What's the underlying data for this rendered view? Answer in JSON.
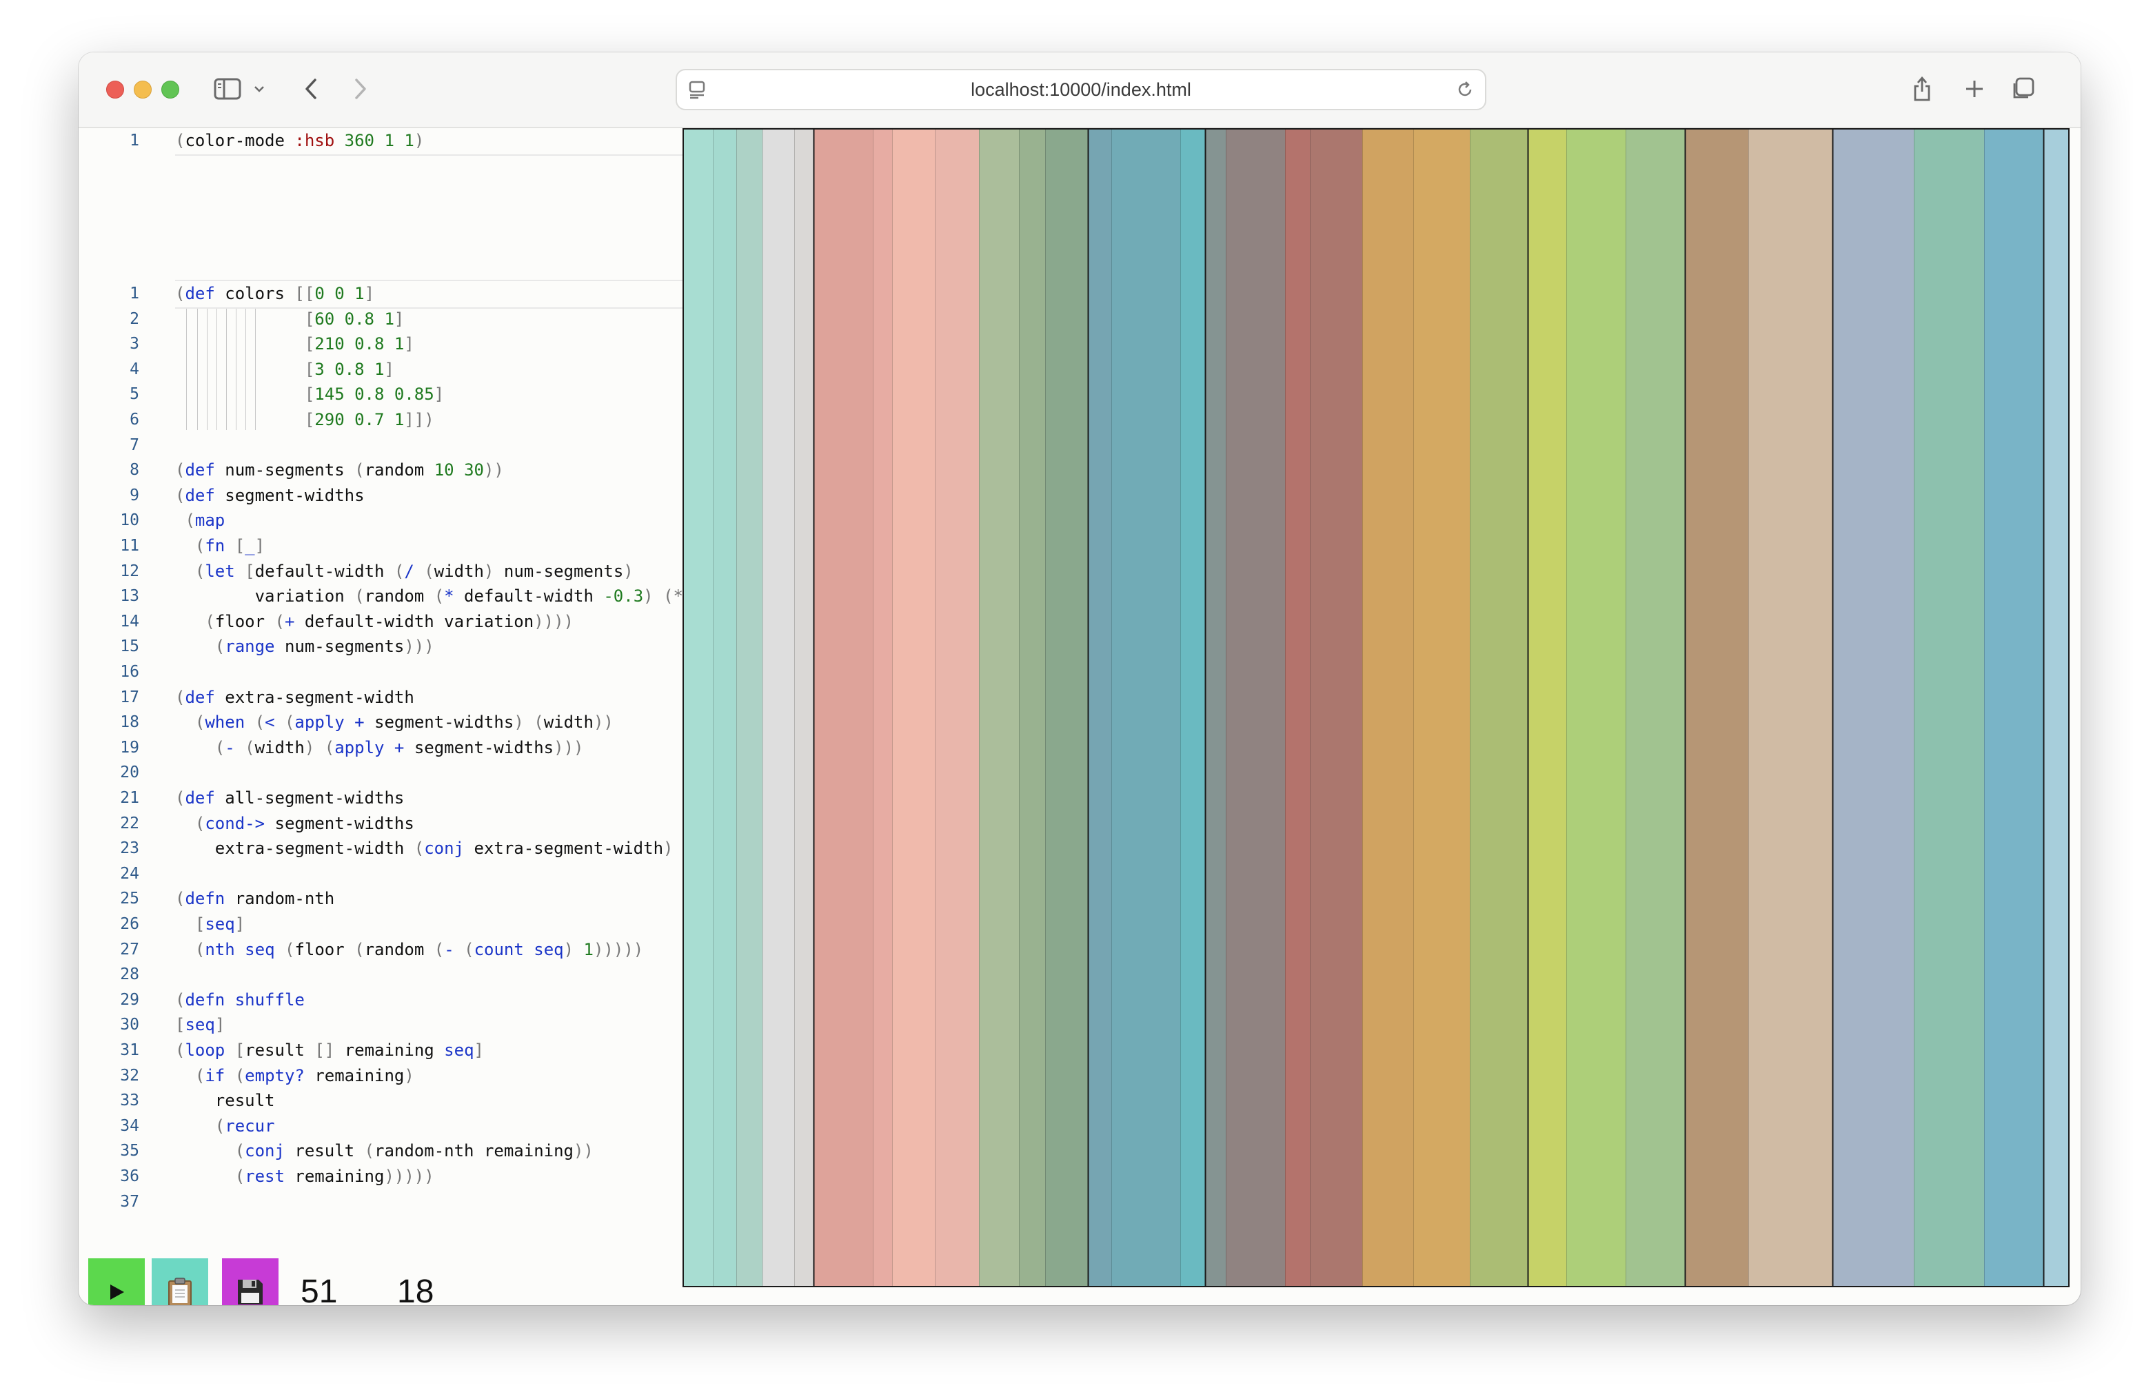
{
  "browser": {
    "url": "localhost:10000/index.html"
  },
  "editor_setup": {
    "lines": [
      {
        "n": "1",
        "tokens": [
          [
            "br",
            "("
          ],
          [
            "t",
            "color-mode "
          ],
          [
            "kwd",
            ":hsb"
          ],
          [
            "t",
            " "
          ],
          [
            "num",
            "360 1 1"
          ],
          [
            "br",
            ")"
          ]
        ]
      }
    ]
  },
  "editor_main": {
    "lines": [
      {
        "n": "1",
        "tokens": [
          [
            "br",
            "("
          ],
          [
            "kw",
            "def"
          ],
          [
            "t",
            " colors "
          ],
          [
            "br",
            "[["
          ],
          [
            "num",
            "0 0 1"
          ],
          [
            "br",
            "]"
          ]
        ]
      },
      {
        "n": "2",
        "tokens": [
          [
            "t",
            "             "
          ],
          [
            "br",
            "["
          ],
          [
            "num",
            "60 0.8 1"
          ],
          [
            "br",
            "]"
          ]
        ]
      },
      {
        "n": "3",
        "tokens": [
          [
            "t",
            "             "
          ],
          [
            "br",
            "["
          ],
          [
            "num",
            "210 0.8 1"
          ],
          [
            "br",
            "]"
          ]
        ]
      },
      {
        "n": "4",
        "tokens": [
          [
            "t",
            "             "
          ],
          [
            "br",
            "["
          ],
          [
            "num",
            "3 0.8 1"
          ],
          [
            "br",
            "]"
          ]
        ]
      },
      {
        "n": "5",
        "tokens": [
          [
            "t",
            "             "
          ],
          [
            "br",
            "["
          ],
          [
            "num",
            "145 0.8 0.85"
          ],
          [
            "br",
            "]"
          ]
        ]
      },
      {
        "n": "6",
        "tokens": [
          [
            "t",
            "             "
          ],
          [
            "br",
            "["
          ],
          [
            "num",
            "290 0.7 1"
          ],
          [
            "br",
            "]])"
          ]
        ]
      },
      {
        "n": "7",
        "tokens": []
      },
      {
        "n": "8",
        "tokens": [
          [
            "br",
            "("
          ],
          [
            "kw",
            "def"
          ],
          [
            "t",
            " num-segments "
          ],
          [
            "br",
            "("
          ],
          [
            "t",
            "random "
          ],
          [
            "num",
            "10 30"
          ],
          [
            "br",
            "))"
          ]
        ]
      },
      {
        "n": "9",
        "tokens": [
          [
            "br",
            "("
          ],
          [
            "kw",
            "def"
          ],
          [
            "t",
            " segment-widths"
          ]
        ]
      },
      {
        "n": "10",
        "tokens": [
          [
            "t",
            " "
          ],
          [
            "br",
            "("
          ],
          [
            "kw",
            "map"
          ]
        ]
      },
      {
        "n": "11",
        "tokens": [
          [
            "t",
            "  "
          ],
          [
            "br",
            "("
          ],
          [
            "kw",
            "fn"
          ],
          [
            "t",
            " "
          ],
          [
            "br",
            "["
          ],
          [
            "kw",
            "_"
          ],
          [
            "br",
            "]"
          ]
        ]
      },
      {
        "n": "12",
        "tokens": [
          [
            "t",
            "  "
          ],
          [
            "br",
            "("
          ],
          [
            "kw",
            "let"
          ],
          [
            "t",
            " "
          ],
          [
            "br",
            "["
          ],
          [
            "t",
            "default-width "
          ],
          [
            "br",
            "("
          ],
          [
            "kw",
            "/"
          ],
          [
            "t",
            " "
          ],
          [
            "br",
            "("
          ],
          [
            "t",
            "width"
          ],
          [
            "br",
            ")"
          ],
          [
            "t",
            " num-segments"
          ],
          [
            "br",
            ")"
          ]
        ]
      },
      {
        "n": "13",
        "tokens": [
          [
            "t",
            "        variation "
          ],
          [
            "br",
            "("
          ],
          [
            "t",
            "random "
          ],
          [
            "br",
            "("
          ],
          [
            "kw",
            "*"
          ],
          [
            "t",
            " default-width "
          ],
          [
            "num",
            "-0.3"
          ],
          [
            "br",
            ")"
          ],
          [
            "t",
            " "
          ],
          [
            "br",
            "(*"
          ]
        ]
      },
      {
        "n": "14",
        "tokens": [
          [
            "t",
            "   "
          ],
          [
            "br",
            "("
          ],
          [
            "t",
            "floor "
          ],
          [
            "br",
            "("
          ],
          [
            "kw",
            "+"
          ],
          [
            "t",
            " default-width variation"
          ],
          [
            "br",
            "))))"
          ]
        ]
      },
      {
        "n": "15",
        "tokens": [
          [
            "t",
            "    "
          ],
          [
            "br",
            "("
          ],
          [
            "kw",
            "range"
          ],
          [
            "t",
            " num-segments"
          ],
          [
            "br",
            ")))"
          ]
        ]
      },
      {
        "n": "16",
        "tokens": []
      },
      {
        "n": "17",
        "tokens": [
          [
            "br",
            "("
          ],
          [
            "kw",
            "def"
          ],
          [
            "t",
            " extra-segment-width"
          ]
        ]
      },
      {
        "n": "18",
        "tokens": [
          [
            "t",
            "  "
          ],
          [
            "br",
            "("
          ],
          [
            "kw",
            "when"
          ],
          [
            "t",
            " "
          ],
          [
            "br",
            "("
          ],
          [
            "kw",
            "<"
          ],
          [
            "t",
            " "
          ],
          [
            "br",
            "("
          ],
          [
            "kw",
            "apply"
          ],
          [
            "t",
            " "
          ],
          [
            "kw",
            "+"
          ],
          [
            "t",
            " segment-widths"
          ],
          [
            "br",
            ")"
          ],
          [
            "t",
            " "
          ],
          [
            "br",
            "("
          ],
          [
            "t",
            "width"
          ],
          [
            "br",
            "))"
          ]
        ]
      },
      {
        "n": "19",
        "tokens": [
          [
            "t",
            "    "
          ],
          [
            "br",
            "("
          ],
          [
            "kw",
            "-"
          ],
          [
            "t",
            " "
          ],
          [
            "br",
            "("
          ],
          [
            "t",
            "width"
          ],
          [
            "br",
            ")"
          ],
          [
            "t",
            " "
          ],
          [
            "br",
            "("
          ],
          [
            "kw",
            "apply"
          ],
          [
            "t",
            " "
          ],
          [
            "kw",
            "+"
          ],
          [
            "t",
            " segment-widths"
          ],
          [
            "br",
            ")))"
          ]
        ]
      },
      {
        "n": "20",
        "tokens": []
      },
      {
        "n": "21",
        "tokens": [
          [
            "br",
            "("
          ],
          [
            "kw",
            "def"
          ],
          [
            "t",
            " all-segment-widths"
          ]
        ]
      },
      {
        "n": "22",
        "tokens": [
          [
            "t",
            "  "
          ],
          [
            "br",
            "("
          ],
          [
            "kw",
            "cond->"
          ],
          [
            "t",
            " segment-widths"
          ]
        ]
      },
      {
        "n": "23",
        "tokens": [
          [
            "t",
            "    extra-segment-width "
          ],
          [
            "br",
            "("
          ],
          [
            "kw",
            "conj"
          ],
          [
            "t",
            " extra-segment-width"
          ],
          [
            "br",
            ")"
          ]
        ]
      },
      {
        "n": "24",
        "tokens": []
      },
      {
        "n": "25",
        "tokens": [
          [
            "br",
            "("
          ],
          [
            "kw",
            "defn"
          ],
          [
            "t",
            " random-nth"
          ]
        ]
      },
      {
        "n": "26",
        "tokens": [
          [
            "t",
            "  "
          ],
          [
            "br",
            "["
          ],
          [
            "kw",
            "seq"
          ],
          [
            "br",
            "]"
          ]
        ]
      },
      {
        "n": "27",
        "tokens": [
          [
            "t",
            "  "
          ],
          [
            "br",
            "("
          ],
          [
            "kw",
            "nth"
          ],
          [
            "t",
            " "
          ],
          [
            "kw",
            "seq"
          ],
          [
            "t",
            " "
          ],
          [
            "br",
            "("
          ],
          [
            "t",
            "floor "
          ],
          [
            "br",
            "("
          ],
          [
            "t",
            "random "
          ],
          [
            "br",
            "("
          ],
          [
            "kw",
            "-"
          ],
          [
            "t",
            " "
          ],
          [
            "br",
            "("
          ],
          [
            "kw",
            "count"
          ],
          [
            "t",
            " "
          ],
          [
            "kw",
            "seq"
          ],
          [
            "br",
            ")"
          ],
          [
            "t",
            " "
          ],
          [
            "num",
            "1"
          ],
          [
            "br",
            ")))))"
          ]
        ]
      },
      {
        "n": "28",
        "tokens": []
      },
      {
        "n": "29",
        "tokens": [
          [
            "br",
            "("
          ],
          [
            "kw",
            "defn"
          ],
          [
            "t",
            " "
          ],
          [
            "kw",
            "shuffle"
          ]
        ]
      },
      {
        "n": "30",
        "tokens": [
          [
            "br",
            "["
          ],
          [
            "kw",
            "seq"
          ],
          [
            "br",
            "]"
          ]
        ]
      },
      {
        "n": "31",
        "tokens": [
          [
            "br",
            "("
          ],
          [
            "kw",
            "loop"
          ],
          [
            "t",
            " "
          ],
          [
            "br",
            "["
          ],
          [
            "t",
            "result "
          ],
          [
            "br",
            "[]"
          ],
          [
            "t",
            " remaining "
          ],
          [
            "kw",
            "seq"
          ],
          [
            "br",
            "]"
          ]
        ]
      },
      {
        "n": "32",
        "tokens": [
          [
            "t",
            "  "
          ],
          [
            "br",
            "("
          ],
          [
            "kw",
            "if"
          ],
          [
            "t",
            " "
          ],
          [
            "br",
            "("
          ],
          [
            "kw",
            "empty?"
          ],
          [
            "t",
            " remaining"
          ],
          [
            "br",
            ")"
          ]
        ]
      },
      {
        "n": "33",
        "tokens": [
          [
            "t",
            "    result"
          ]
        ]
      },
      {
        "n": "34",
        "tokens": [
          [
            "t",
            "    "
          ],
          [
            "br",
            "("
          ],
          [
            "kw",
            "recur"
          ]
        ]
      },
      {
        "n": "35",
        "tokens": [
          [
            "t",
            "      "
          ],
          [
            "br",
            "("
          ],
          [
            "kw",
            "conj"
          ],
          [
            "t",
            " result "
          ],
          [
            "br",
            "("
          ],
          [
            "t",
            "random-nth remaining"
          ],
          [
            "br",
            "))"
          ]
        ]
      },
      {
        "n": "36",
        "tokens": [
          [
            "t",
            "      "
          ],
          [
            "br",
            "("
          ],
          [
            "kw",
            "rest"
          ],
          [
            "t",
            " remaining"
          ],
          [
            "br",
            ")))))"
          ]
        ]
      },
      {
        "n": "37",
        "tokens": []
      }
    ]
  },
  "controls": {
    "run_icon": "play-icon",
    "copy_icon": "clipboard-icon",
    "save_icon": "floppy-disk-icon",
    "counter_a": "51",
    "counter_b": "18"
  },
  "canvas": {
    "segment_widths": [
      44,
      34,
      38,
      46,
      28,
      86,
      28,
      62,
      64,
      58,
      38,
      62,
      34,
      100,
      36,
      30,
      86,
      36,
      76,
      74,
      82,
      84,
      56,
      86,
      86,
      92,
      122,
      118,
      102,
      86,
      88,
      96,
      88,
      80
    ],
    "segment_colors": [
      "#a3dbd0",
      "#9fd8cc",
      "#a9d0c3",
      "#dcdcdc",
      "#d8d6d4",
      "#dc9e95",
      "#e6a89e",
      "#efb6a8",
      "#e8b2a6",
      "#a7bb96",
      "#93ae8a",
      "#84a387",
      "#6fa0ae",
      "#69a7b2",
      "#62b6be",
      "#7e8e8c",
      "#8a7c7a",
      "#b06b64",
      "#a77066",
      "#cd9e58",
      "#d2a45a",
      "#a6b96d",
      "#c3d060",
      "#a9cc72",
      "#9cc08a",
      "#b2906e",
      "#ceb79f",
      "#a0b0c4",
      "#87beaa",
      "#72b0c4",
      "#a2cbd9",
      "#c2dda3",
      "#c9a27e",
      "#dec4a6"
    ],
    "extra_colors": [
      "#e0998a",
      "#e9bdb1"
    ],
    "bordered": [
      true,
      false,
      false,
      false,
      false,
      true,
      false,
      false,
      false,
      false,
      false,
      false,
      true,
      false,
      false,
      true,
      false,
      false,
      false,
      false,
      false,
      false,
      true,
      false,
      false,
      true,
      false,
      true,
      false,
      false,
      true,
      false,
      true,
      false
    ]
  }
}
